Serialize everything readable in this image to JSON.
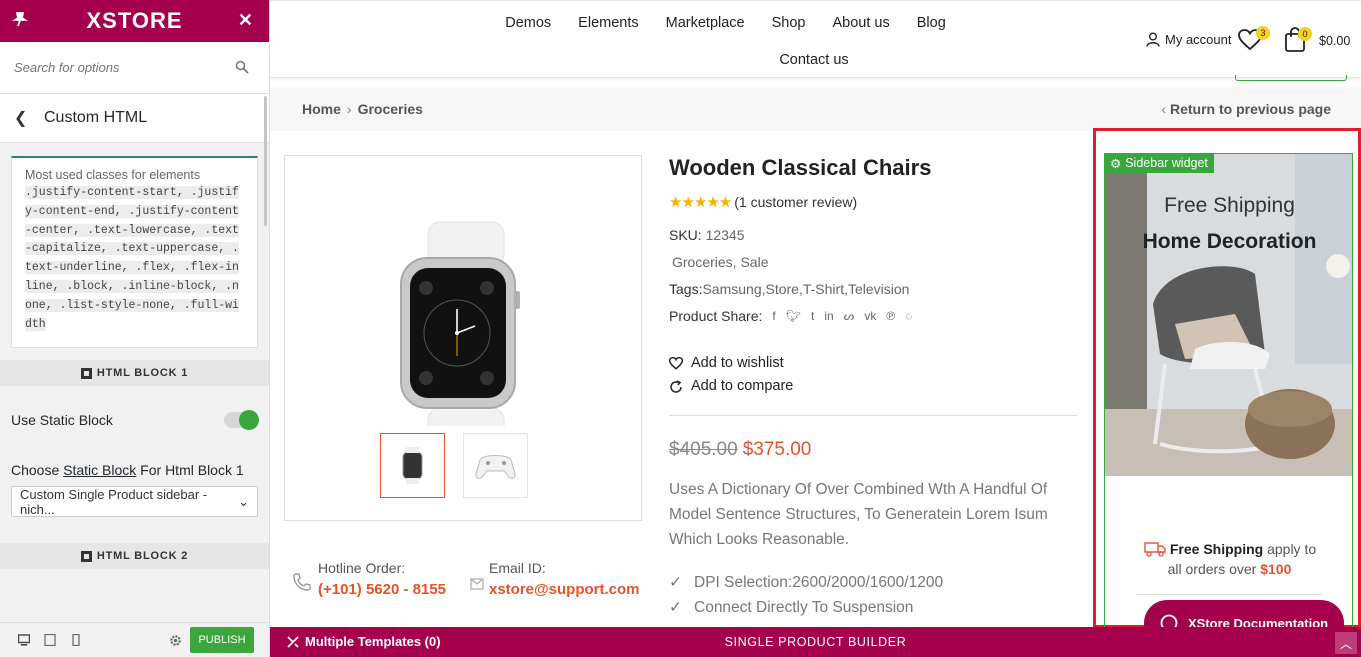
{
  "customizer": {
    "logo": "XSTORE",
    "search_placeholder": "Search for options",
    "section_title": "Custom HTML",
    "classes_heading": "Most used classes for elements",
    "classes_list": ".justify-content-start, .justify-content-end, .justify-content-center, .text-lowercase, .text-capitalize, .text-uppercase, .text-underline, .flex, .flex-inline, .block, .inline-block, .none, .list-style-none, .full-width",
    "block1_title": "HTML BLOCK 1",
    "use_static_label": "Use Static Block",
    "choose_prefix": "Choose ",
    "choose_link": "Static Block",
    "choose_suffix": " For Html Block 1",
    "select_value": "Custom Single Product sidebar - nich...",
    "block2_title": "HTML BLOCK 2",
    "publish_label": "PUBLISH"
  },
  "header": {
    "nav": [
      "Demos",
      "Elements",
      "Marketplace",
      "Shop",
      "About us",
      "Blog"
    ],
    "nav_row2": "Contact us",
    "account": "My account",
    "wishlist_count": "3",
    "cart_count": "0",
    "cart_total": "$0.00"
  },
  "breadcrumb": {
    "home": "Home",
    "current": "Groceries",
    "return": "Return to previous page"
  },
  "product": {
    "title": "Wooden Classical Chairs",
    "rating": 5,
    "reviews": "(1 customer review)",
    "sku_label": "SKU:",
    "sku": "12345",
    "categories": "Groceries, Sale",
    "tags_label": "Tags:",
    "tags": "Samsung,Store,T-Shirt,Television",
    "share_label": "Product Share:",
    "wishlist": "Add to wishlist",
    "compare": "Add to compare",
    "old_price": "$405.00",
    "new_price": "$375.00",
    "description": "Uses A Dictionary Of Over Combined Wth A Handful Of Model Sentence Structures, To Generatein Lorem Isum Which Looks Reasonable.",
    "features": [
      "DPI Selection:2600/2000/1600/1200",
      "Connect Directly To Suspension"
    ]
  },
  "contact": {
    "hotline_label": "Hotline Order:",
    "hotline": "(+101) 5620 - 8155",
    "email_label": "Email ID:",
    "email": "xstore@support.com"
  },
  "widget": {
    "tag": "Sidebar widget",
    "banner_line1": "Free Shipping",
    "banner_line2": "Home Decoration",
    "ship_bold": "Free Shipping",
    "ship_rest": " apply to",
    "ship_line2": "all orders over ",
    "ship_amount": "$100"
  },
  "doc_button": "XStore Documentation",
  "bottom_bar": {
    "templates": "Multiple Templates (0)",
    "builder": "SINGLE PRODUCT BUILDER"
  },
  "colors": {
    "brand": "#a5004e",
    "accent": "#e4532a",
    "green": "#3aa63c",
    "highlight": "#e01d2c"
  }
}
